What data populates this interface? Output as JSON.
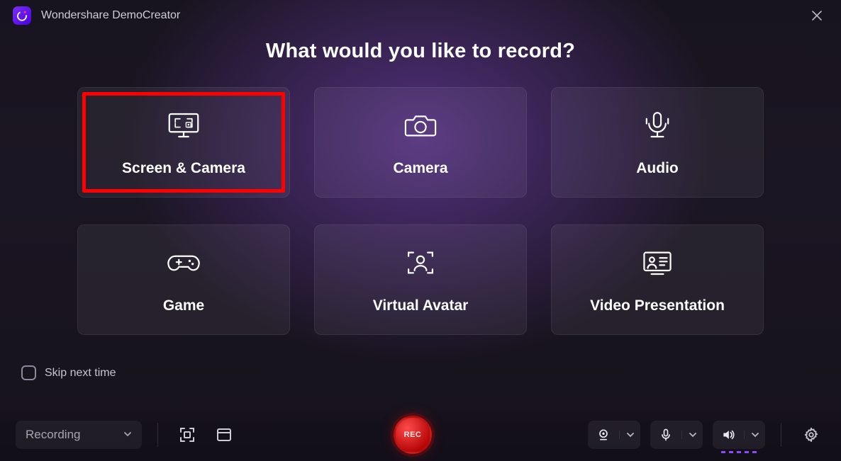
{
  "app": {
    "title": "Wondershare DemoCreator"
  },
  "heading": "What would you like to record?",
  "cards": [
    {
      "label": "Screen & Camera",
      "highlight": true
    },
    {
      "label": "Camera"
    },
    {
      "label": "Audio"
    },
    {
      "label": "Game"
    },
    {
      "label": "Virtual Avatar"
    },
    {
      "label": "Video Presentation"
    }
  ],
  "skip": {
    "label": "Skip next time",
    "checked": false
  },
  "toolbar": {
    "mode_label": "Recording",
    "rec_label": "REC"
  }
}
